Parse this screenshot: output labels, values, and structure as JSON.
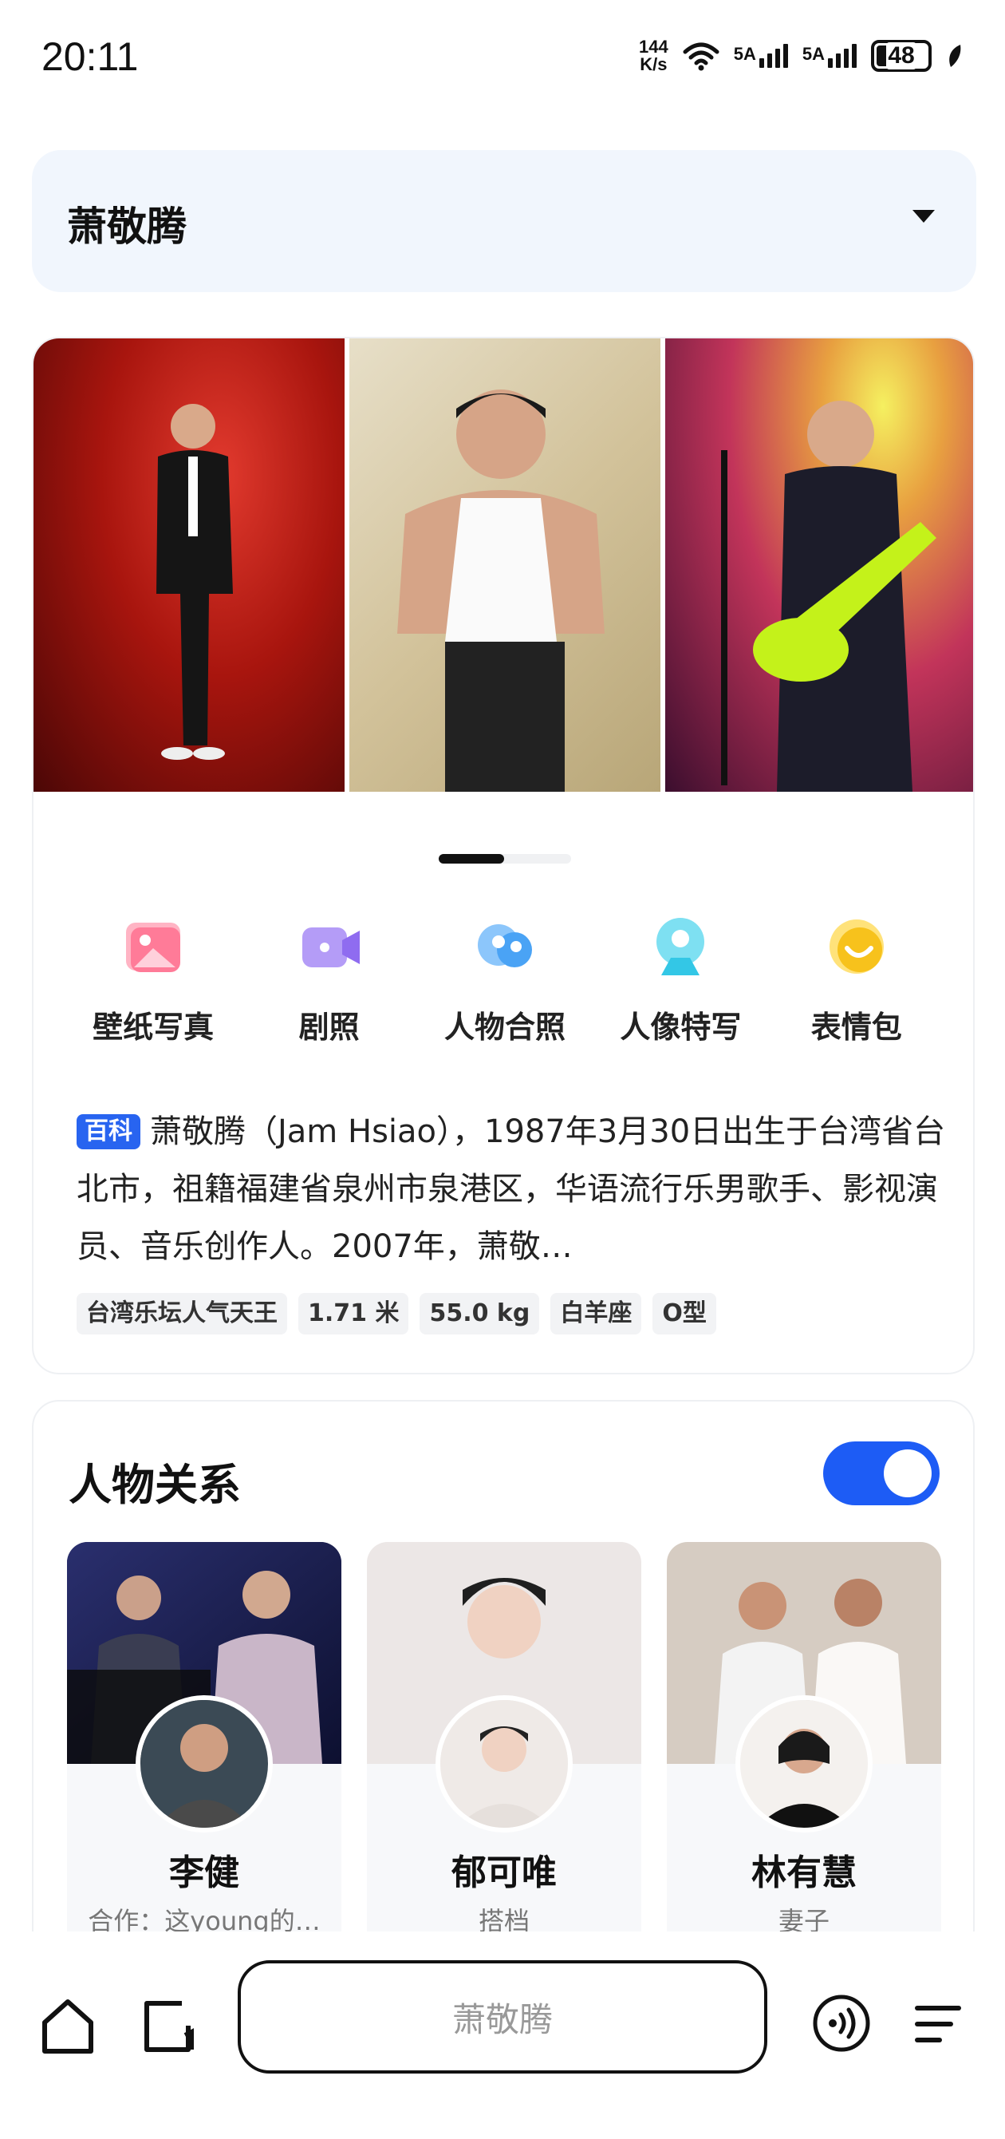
{
  "status_bar": {
    "time": "20:11",
    "net_speed_value": "144",
    "net_speed_unit": "K/s",
    "signal_1": "5A",
    "signal_2": "5A",
    "battery": "48"
  },
  "header": {
    "query": "萧敬腾",
    "dropdown_icon": "chevron-down-icon"
  },
  "gallery": {
    "page_count": 2,
    "active_page": 1
  },
  "quick_actions": [
    {
      "label": "壁纸写真",
      "icon": "image-icon",
      "color": "#ff6f8e"
    },
    {
      "label": "剧照",
      "icon": "video-icon",
      "color": "#a57cf5"
    },
    {
      "label": "人物合照",
      "icon": "people-icon",
      "color": "#4aa3f5"
    },
    {
      "label": "人像特写",
      "icon": "portrait-icon",
      "color": "#33c7e6"
    },
    {
      "label": "表情包",
      "icon": "smile-icon",
      "color": "#f7c21c"
    }
  ],
  "bio": {
    "badge": "百科",
    "text": "萧敬腾（Jam Hsiao），1987年3月30日出生于台湾省台北市，祖籍福建省泉州市泉港区，华语流行乐男歌手、影视演员、音乐创作人。2007年，萧敬…",
    "tags": [
      "台湾乐坛人气天王",
      "1.71 米",
      "55.0 kg",
      "白羊座",
      "O型"
    ]
  },
  "relations": {
    "title": "人物关系",
    "toggle_on": true,
    "items": [
      {
        "name": "李健",
        "desc": "合作：这young的…"
      },
      {
        "name": "郁可唯",
        "desc": "搭档"
      },
      {
        "name": "林有慧",
        "desc": "妻子"
      }
    ]
  },
  "bottom_nav": {
    "search_placeholder": "萧敬腾"
  },
  "colors": {
    "accent": "#1d5cf5",
    "header_bg": "#f1f6fd"
  }
}
